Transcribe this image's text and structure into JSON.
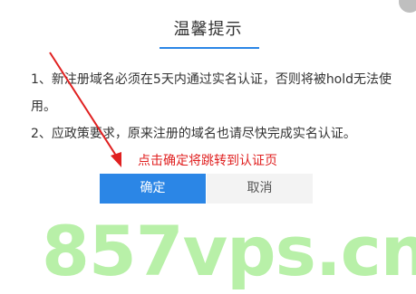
{
  "dialog": {
    "title": "温馨提示",
    "message_1": "1、新注册域名必须在5天内通过实名认证，否则将被hold无法使用。",
    "message_2": "2、应政策要求，原来注册的域名也请尽快完成实名认证。",
    "ok_label": "确定",
    "cancel_label": "取消"
  },
  "annotation": {
    "hint": "点击确定将跳转到认证页",
    "color": "#e02020"
  },
  "watermark": {
    "text": "857vps.cn",
    "color": "#b8f0a8"
  },
  "colors": {
    "accent": "#2b86e6",
    "cancel_bg": "#f3f3f3"
  }
}
